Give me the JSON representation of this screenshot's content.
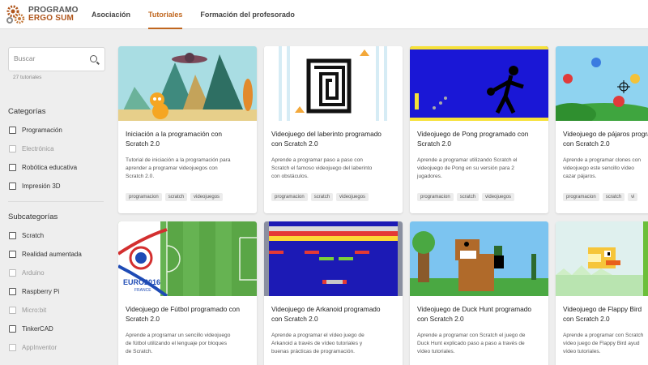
{
  "brand": {
    "line1": "PROGRAMO",
    "line2": "ERGO SUM",
    "color": "#b0561c"
  },
  "nav": [
    {
      "label": "Asociación",
      "active": false
    },
    {
      "label": "Tutoriales",
      "active": true
    },
    {
      "label": "Formación del profesorado",
      "active": false
    }
  ],
  "sidebar": {
    "search_placeholder": "Buscar",
    "search_icon": "search-icon",
    "count": "27 tutoriales",
    "categories_title": "Categorías",
    "categories": [
      {
        "label": "Programación",
        "disabled": false
      },
      {
        "label": "Electrónica",
        "disabled": true
      },
      {
        "label": "Robótica educativa",
        "disabled": false
      },
      {
        "label": "Impresión 3D",
        "disabled": false
      }
    ],
    "subcategories_title": "Subcategorías",
    "subcategories": [
      {
        "label": "Scratch",
        "disabled": false
      },
      {
        "label": "Realidad aumentada",
        "disabled": false
      },
      {
        "label": "Arduino",
        "disabled": true
      },
      {
        "label": "Raspberry Pi",
        "disabled": false
      },
      {
        "label": "Micro:bit",
        "disabled": true
      },
      {
        "label": "TinkerCAD",
        "disabled": false
      },
      {
        "label": "AppInventor",
        "disabled": true
      }
    ]
  },
  "cards": [
    {
      "title_l1": "Iniciación a la programación con",
      "title_l2": "Scratch 2.0",
      "desc": [
        "Tutorial de iniciación a la programación para",
        "aprender a programar videojuegos con",
        "Scratch 2.0."
      ],
      "tags": [
        "programacion",
        "scratch",
        "videojuegos"
      ]
    },
    {
      "title_l1": "Videojuego del laberinto programado",
      "title_l2": "con Scratch 2.0",
      "desc": [
        "Aprende a programar paso a paso con",
        "Scratch el famoso videojuego del laberinto",
        "con obstáculos."
      ],
      "tags": [
        "programacion",
        "scratch",
        "videojuegos"
      ]
    },
    {
      "title_l1": "Videojuego de Pong programado con",
      "title_l2": "Scratch 2.0",
      "desc": [
        "Aprende a programar utilizando Scratch el",
        "videojuego de Pong en su versión para 2",
        "jugadores."
      ],
      "tags": [
        "programacion",
        "scratch",
        "videojuegos"
      ]
    },
    {
      "title_l1": "Videojuego de pájaros programado",
      "title_l2": "con Scratch 2.0",
      "desc": [
        "Aprende a programar clones con",
        "videojuego este sencillo vídeo",
        "cazar pájaros."
      ],
      "tags": [
        "programacion",
        "scratch",
        "vi"
      ]
    },
    {
      "title_l1": "Videojuego de Fútbol programado con",
      "title_l2": "Scratch 2.0",
      "desc": [
        "Aprende a programar un sencillo videojuego",
        "de fútbol utilizando el lenguaje por bloques",
        "de Scratch."
      ],
      "tags": []
    },
    {
      "title_l1": "Videojuego de Arkanoid programado",
      "title_l2": "con Scratch 2.0",
      "desc": [
        "Aprende a programar el vídeo juego de",
        "Arkanoid a través de vídeo tutoriales y",
        "buenas prácticas de programación."
      ],
      "tags": []
    },
    {
      "title_l1": "Videojuego de Duck Hunt programado",
      "title_l2": "con Scratch 2.0",
      "desc": [
        "Aprende a programar con Scratch el juego de",
        "Duck Hunt explicado paso a paso a través de",
        "vídeo tutoriales."
      ],
      "tags": []
    },
    {
      "title_l1": "Videojuego de Flappy Bird",
      "title_l2": "con Scratch 2.0",
      "desc": [
        "Aprende a programar con Scratch",
        "vídeo juego de Flappy Bird ayud",
        "vídeo tutoriales."
      ],
      "tags": []
    }
  ],
  "euro_text": {
    "l1": "EURO2016",
    "l2": "FRANCE"
  }
}
